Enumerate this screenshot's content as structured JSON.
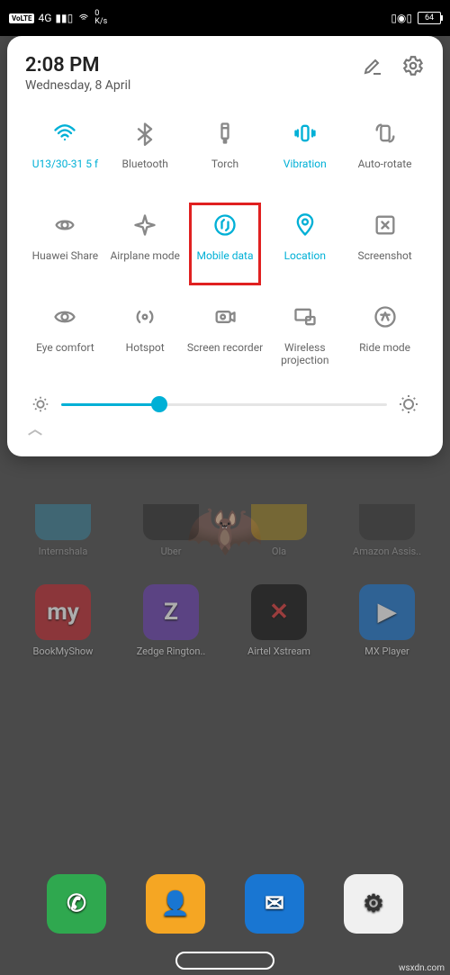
{
  "status": {
    "volte": "VoLTE",
    "net": "4G",
    "speed_val": "0",
    "speed_unit": "K/s",
    "battery": "64"
  },
  "panel": {
    "time": "2:08 PM",
    "date": "Wednesday, 8 April"
  },
  "toggles": [
    {
      "label": "U13/30-31 5 f",
      "icon": "wifi",
      "active": true
    },
    {
      "label": "Bluetooth",
      "icon": "bluetooth",
      "active": false
    },
    {
      "label": "Torch",
      "icon": "torch",
      "active": false
    },
    {
      "label": "Vibration",
      "icon": "vibration",
      "active": true
    },
    {
      "label": "Auto-rotate",
      "icon": "rotate",
      "active": false
    },
    {
      "label": "Huawei Share",
      "icon": "share",
      "active": false
    },
    {
      "label": "Airplane mode",
      "icon": "airplane",
      "active": false
    },
    {
      "label": "Mobile data",
      "icon": "data",
      "active": true,
      "highlighted": true
    },
    {
      "label": "Location",
      "icon": "location",
      "active": true
    },
    {
      "label": "Screenshot",
      "icon": "screenshot",
      "active": false
    },
    {
      "label": "Eye comfort",
      "icon": "eye",
      "active": false
    },
    {
      "label": "Hotspot",
      "icon": "hotspot",
      "active": false
    },
    {
      "label": "Screen recorder",
      "icon": "record",
      "active": false
    },
    {
      "label": "Wireless projection",
      "icon": "cast",
      "active": false
    },
    {
      "label": "Ride mode",
      "icon": "ride",
      "active": false
    }
  ],
  "brightness": {
    "percent": 30
  },
  "apps_partial": [
    {
      "label": "Internshala",
      "color": "#27b2e0"
    },
    {
      "label": "Uber",
      "color": "#111"
    },
    {
      "label": "Ola",
      "color": "#e8b400"
    },
    {
      "label": "Amazon Assis..",
      "color": "#222"
    }
  ],
  "apps_row": [
    {
      "label": "BookMyShow",
      "color": "#c1272d",
      "text": "my"
    },
    {
      "label": "Zedge Rington..",
      "color": "#6a3fb3",
      "text": "Z"
    },
    {
      "label": "Airtel Xstream",
      "color": "#111",
      "text": "✕",
      "textcolor": "#d33"
    },
    {
      "label": "MX Player",
      "color": "#1976d2",
      "text": "▶"
    }
  ],
  "dock": [
    {
      "name": "phone",
      "color": "#2fa84f",
      "text": "✆"
    },
    {
      "name": "contacts",
      "color": "#f5a623",
      "text": "👤"
    },
    {
      "name": "messages",
      "color": "#1976d2",
      "text": "✉"
    },
    {
      "name": "settings",
      "color": "#f0f0f0",
      "text": "⚙",
      "textcolor": "#333"
    }
  ],
  "watermark": "wsxdn.com"
}
